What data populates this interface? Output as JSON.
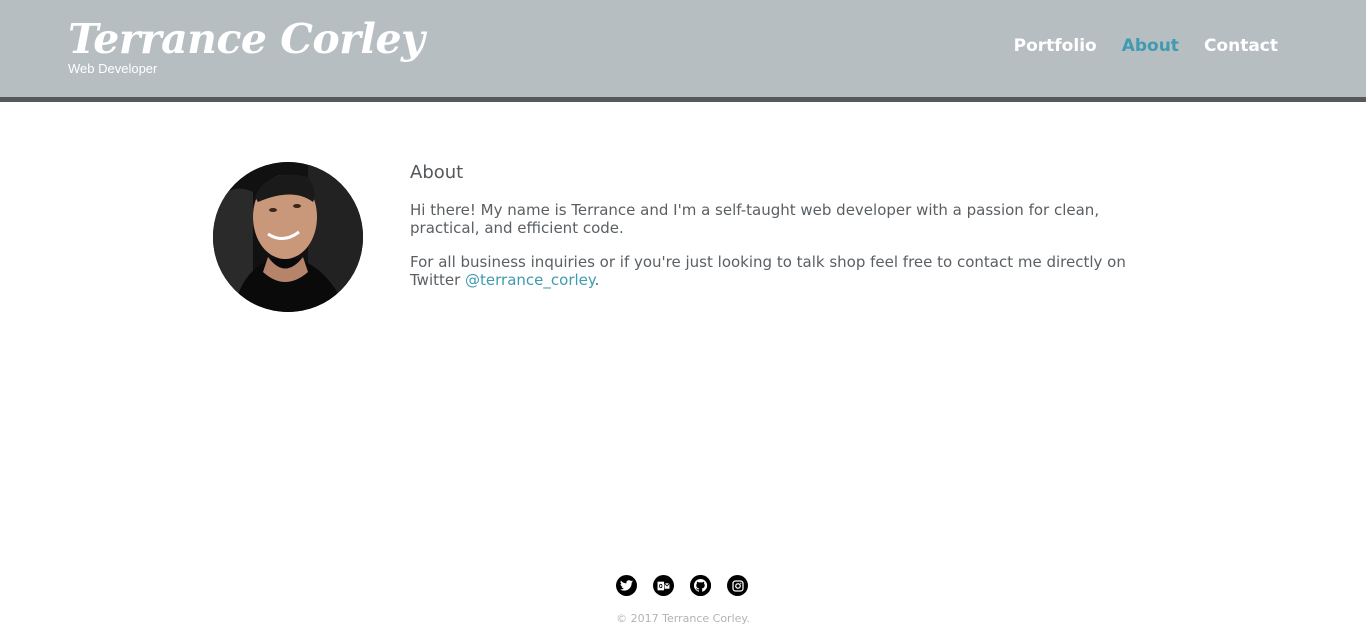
{
  "header": {
    "brand_name": "Terrance Corley",
    "brand_subtitle": "Web Developer",
    "nav": [
      {
        "label": "Portfolio",
        "active": false
      },
      {
        "label": "About",
        "active": true
      },
      {
        "label": "Contact",
        "active": false
      }
    ]
  },
  "about": {
    "heading": "About",
    "paragraph1": "Hi there! My name is Terrance and I'm a self-taught web developer with a passion for clean, practical, and efficient code.",
    "paragraph2_prefix": "For all business inquiries or if you're just looking to talk shop feel free to contact me directly on Twitter ",
    "twitter_handle": "@terrance_corley",
    "paragraph2_suffix": "."
  },
  "footer": {
    "social_icons": [
      "twitter-icon",
      "outlook-icon",
      "github-icon",
      "instagram-icon"
    ],
    "copyright": "© 2017 Terrance Corley."
  },
  "colors": {
    "header_bg": "#b6bec2",
    "header_border": "#55595c",
    "accent": "#3f9bb0",
    "text": "#5a5f63"
  }
}
